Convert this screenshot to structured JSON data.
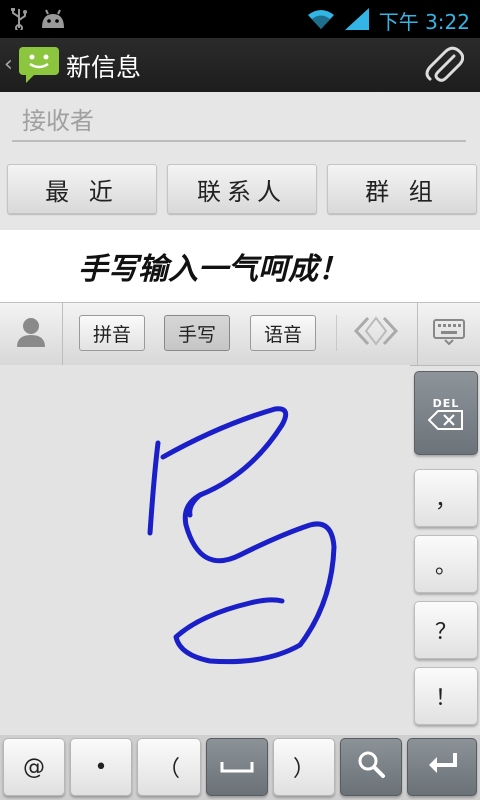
{
  "status_bar": {
    "time": "下午 3:22"
  },
  "action_bar": {
    "title": "新信息"
  },
  "recipient": {
    "placeholder": "接收者"
  },
  "tabs": [
    {
      "label": "最 近"
    },
    {
      "label": "联系人"
    },
    {
      "label": "群 组"
    }
  ],
  "banner": {
    "text": "手写输入一气呵成！"
  },
  "ime": {
    "modes": [
      {
        "label": "拼音",
        "active": false
      },
      {
        "label": "手写",
        "active": true
      },
      {
        "label": "语音",
        "active": false
      }
    ]
  },
  "side_keys": {
    "del": "DEL",
    "comma": "，",
    "period": "。",
    "question": "？",
    "exclaim": "！"
  },
  "bottom_keys": {
    "at": "@",
    "dot": "•",
    "lparen": "（",
    "rparen": "）"
  },
  "colors": {
    "accent": "#33b5e5",
    "stroke": "#1a1fc8"
  }
}
